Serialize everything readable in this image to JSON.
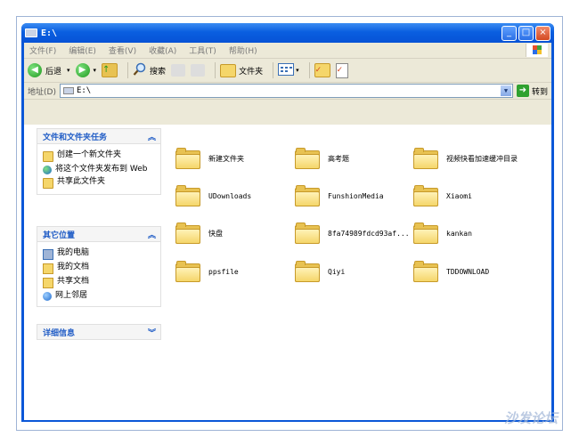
{
  "window": {
    "title": "E:\\"
  },
  "menu": [
    "文件(F)",
    "编辑(E)",
    "查看(V)",
    "收藏(A)",
    "工具(T)",
    "帮助(H)"
  ],
  "toolbar": {
    "back_label": "后退",
    "search_label": "搜索",
    "folders_label": "文件夹"
  },
  "address": {
    "label": "地址(D)",
    "value": "E:\\",
    "go_label": "转到"
  },
  "tasks_panel": {
    "title": "文件和文件夹任务",
    "items": [
      "创建一个新文件夹",
      "将这个文件夹发布到 Web",
      "共享此文件夹"
    ]
  },
  "places_panel": {
    "title": "其它位置",
    "items": [
      "我的电脑",
      "我的文档",
      "共享文档",
      "网上邻居"
    ]
  },
  "details_panel": {
    "title": "详细信息"
  },
  "folders": [
    "新建文件夹",
    "高考题",
    "视频快看加速缓冲目录",
    "UDownloads",
    "FunshionMedia",
    "Xiaomi",
    "快盘",
    "8fa74989fdcd93af...",
    "kankan",
    "ppsfile",
    "Qiyi",
    "TDDOWNLOAD"
  ],
  "watermark": "沙发论坛",
  "colors": {
    "titlebar": "#0a5fe0",
    "panel_title": "#215dc6",
    "folder": "#f5d66a"
  }
}
